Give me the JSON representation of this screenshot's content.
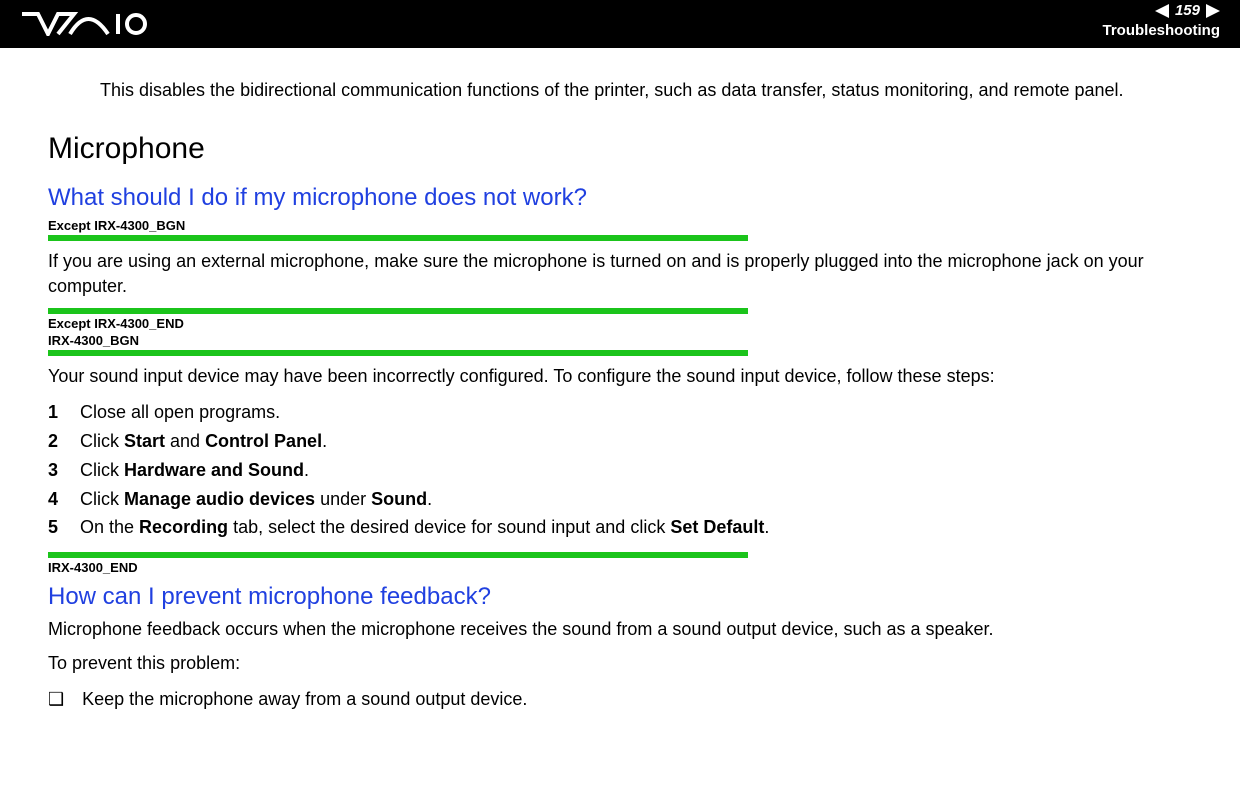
{
  "header": {
    "page_number": "159",
    "section": "Troubleshooting"
  },
  "content": {
    "intro": "This disables the bidirectional communication functions of the printer, such as data transfer, status monitoring, and remote panel.",
    "h1": "Microphone",
    "q1": "What should I do if my microphone does not work?",
    "tag1": "Except IRX-4300_BGN",
    "p1": "If you are using an external microphone, make sure the microphone is turned on and is properly plugged into the microphone jack on your computer.",
    "tag2a": "Except IRX-4300_END",
    "tag2b": "IRX-4300_BGN",
    "p2": "Your sound input device may have been incorrectly configured. To configure the sound input device, follow these steps:",
    "steps": [
      {
        "num": "1",
        "prefix": "",
        "bold": "",
        "text": "Close all open programs."
      },
      {
        "num": "2",
        "prefix": "Click ",
        "bold": "Start",
        "mid": " and ",
        "bold2": "Control Panel",
        "suffix": "."
      },
      {
        "num": "3",
        "prefix": "Click ",
        "bold": "Hardware and Sound",
        "suffix": "."
      },
      {
        "num": "4",
        "prefix": "Click ",
        "bold": "Manage audio devices",
        "mid": " under ",
        "bold2": "Sound",
        "suffix": "."
      },
      {
        "num": "5",
        "prefix": "On the ",
        "bold": "Recording",
        "mid": " tab, select the desired device for sound input and click ",
        "bold2": "Set Default",
        "suffix": "."
      }
    ],
    "tag3": "IRX-4300_END",
    "q2": "How can I prevent microphone feedback?",
    "p3": "Microphone feedback occurs when the microphone receives the sound from a sound output device, such as a speaker.",
    "p4": "To prevent this problem:",
    "bullets": [
      "Keep the microphone away from a sound output device."
    ],
    "bullet_mark": "❑"
  }
}
